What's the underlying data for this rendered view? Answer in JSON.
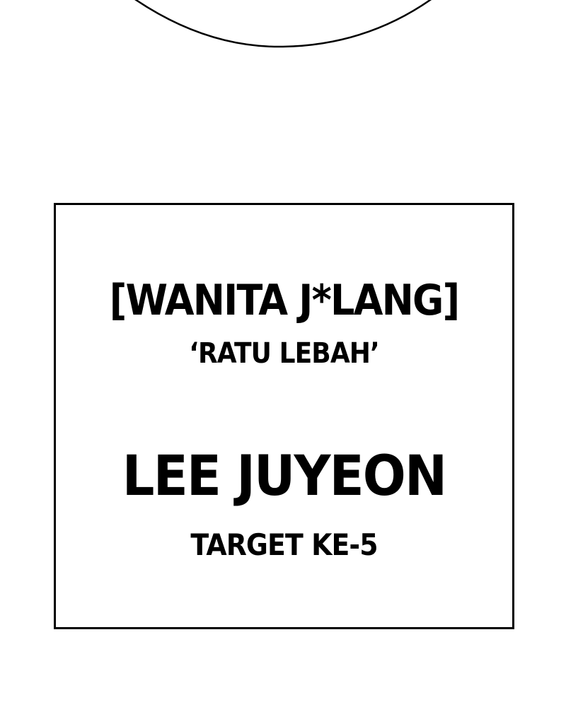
{
  "caption": {
    "title": "[WANITA J*LANG]",
    "subtitle": "‘RATU LEBAH’",
    "name": "LEE JUYEON",
    "target": "TARGET KE-5"
  },
  "colors": {
    "background": "#ffffff",
    "ink": "#000000"
  }
}
